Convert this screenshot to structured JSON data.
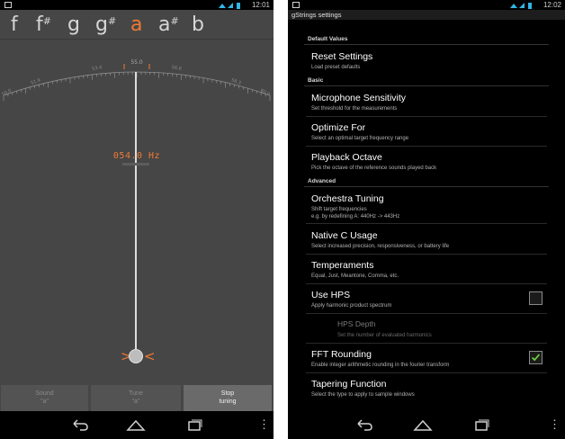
{
  "left_app": {
    "status": {
      "time": "12:01"
    },
    "notes": [
      {
        "letter": "f",
        "sharp": ""
      },
      {
        "letter": "f",
        "sharp": "#"
      },
      {
        "letter": "g",
        "sharp": ""
      },
      {
        "letter": "g",
        "sharp": "#"
      },
      {
        "letter": "a",
        "sharp": "",
        "active": true
      },
      {
        "letter": "a",
        "sharp": "#"
      },
      {
        "letter": "b",
        "sharp": ""
      }
    ],
    "scale": {
      "center_label": "55.0",
      "left_labels": [
        "53.4",
        "51.9",
        "50.0"
      ],
      "right_labels": [
        "56.6",
        "58.3",
        "60.0"
      ]
    },
    "frequency": "054.0 Hz",
    "buttons": {
      "sound": {
        "label": "Sound",
        "value": "\"a\""
      },
      "tune": {
        "label": "Tune",
        "value": "\"a\""
      },
      "stop": {
        "label": "Stop",
        "value": "tuning"
      }
    },
    "nav": {
      "back_icon": "back-arrow-icon",
      "home_icon": "home-icon",
      "recents_icon": "recent-apps-icon",
      "menu_icon": "overflow-menu-icon"
    }
  },
  "right_app": {
    "status": {
      "time": "12:02"
    },
    "title": "gStrings settings",
    "categories": {
      "default": "Default Values",
      "basic": "Basic",
      "advanced": "Advanced"
    },
    "prefs": {
      "reset": {
        "title": "Reset Settings",
        "summary": "Load preset defaults"
      },
      "mic": {
        "title": "Microphone Sensitivity",
        "summary": "Set threshold for the measurements"
      },
      "optimize": {
        "title": "Optimize For",
        "summary": "Select an optimal target frequency range"
      },
      "octave": {
        "title": "Playback Octave",
        "summary": "Pick the octave of the reference sounds played back"
      },
      "orchestra": {
        "title": "Orchestra Tuning",
        "summary": "Shift target frequencies",
        "summary2": "e.g. by redefining A: 440Hz -> 443Hz"
      },
      "native": {
        "title": "Native C Usage",
        "summary": "Select increased precision, responsiveness, or battery life"
      },
      "temperaments": {
        "title": "Temperaments",
        "summary": "Equal, Just, Meantone, Comma, etc."
      },
      "hps": {
        "title": "Use HPS",
        "summary": "Apply harmonic product spectrum",
        "checked": false
      },
      "hps_depth": {
        "title": "HPS Depth",
        "summary": "Set the number of evaluated harmonics"
      },
      "fft": {
        "title": "FFT Rounding",
        "summary": "Enable integer arithmetic rounding in the fourier transform",
        "checked": true
      },
      "tapering": {
        "title": "Tapering Function",
        "summary": "Select the type to apply to sample windows"
      }
    },
    "colors": {
      "accent": "#ee7a33",
      "checkmark": "#6fcf3d"
    }
  }
}
